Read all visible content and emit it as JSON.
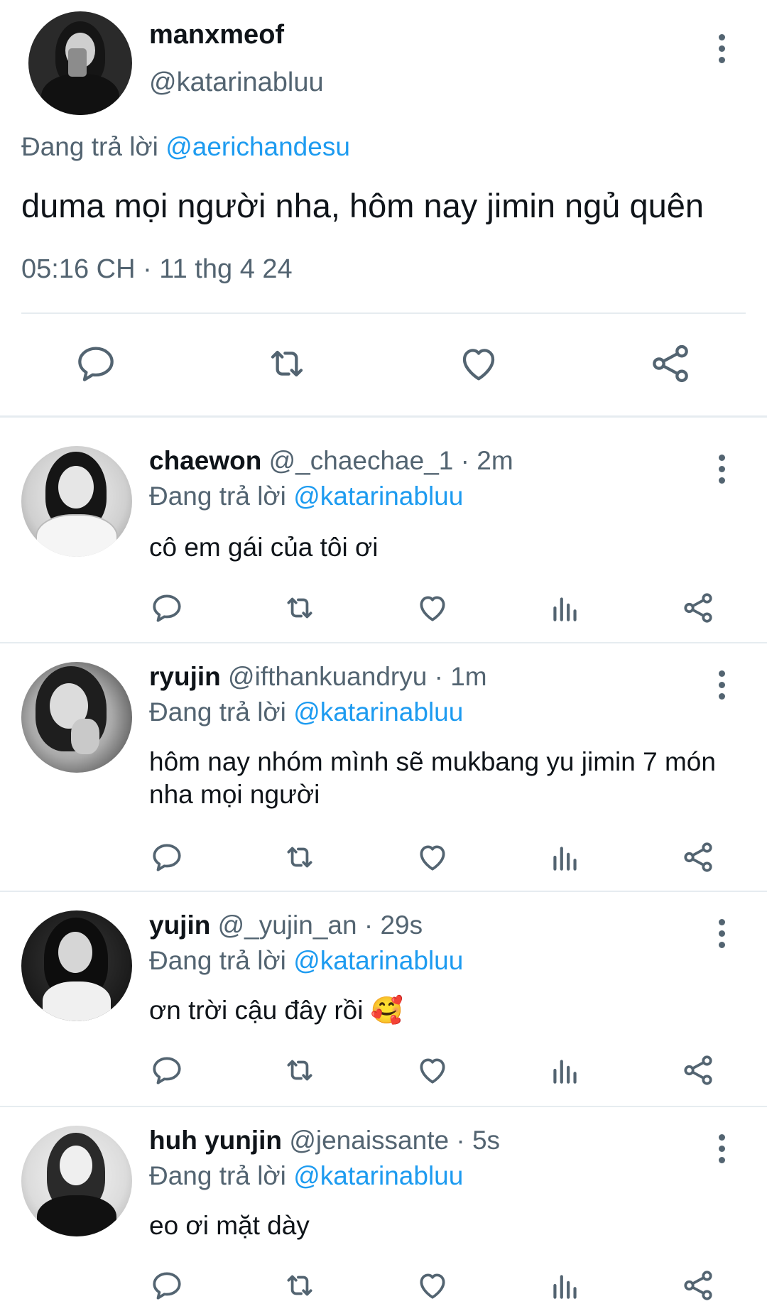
{
  "main_tweet": {
    "display_name": "manxmeof",
    "handle": "@katarinabluu",
    "reply_prefix": "Đang trả lời",
    "reply_mention": "@aerichandesu",
    "text": "duma mọi người nha, hôm nay jimin ngủ quên",
    "timestamp": "05:16 CH · 11 thg 4 24"
  },
  "replies": [
    {
      "display_name": "chaewon",
      "meta": "@_chaechae_1 · 2m",
      "reply_prefix": "Đang trả lời",
      "reply_mention": "@katarinabluu",
      "text": "cô em gái của tôi ơi"
    },
    {
      "display_name": "ryujin",
      "meta": "@ifthankuandryu · 1m",
      "reply_prefix": "Đang trả lời",
      "reply_mention": "@katarinabluu",
      "text": "hôm nay nhóm mình sẽ mukbang yu jimin 7 món nha mọi người"
    },
    {
      "display_name": "yujin",
      "meta": "@_yujin_an · 29s",
      "reply_prefix": "Đang trả lời",
      "reply_mention": "@katarinabluu",
      "text": "ơn trời cậu đây rồi 🥰"
    },
    {
      "display_name": "huh yunjin",
      "meta": "@jenaissante · 5s",
      "reply_prefix": "Đang trả lời",
      "reply_mention": "@katarinabluu",
      "text": "eo ơi mặt dày"
    }
  ],
  "icons": {
    "reply": "reply-icon",
    "retweet": "retweet-icon",
    "like": "heart-icon",
    "views": "views-icon",
    "share": "share-icon",
    "more": "more-options-icon"
  },
  "colors": {
    "text": "#0f1419",
    "secondary": "#536471",
    "link": "#1d9bf0",
    "divider": "#e6ecf0"
  }
}
